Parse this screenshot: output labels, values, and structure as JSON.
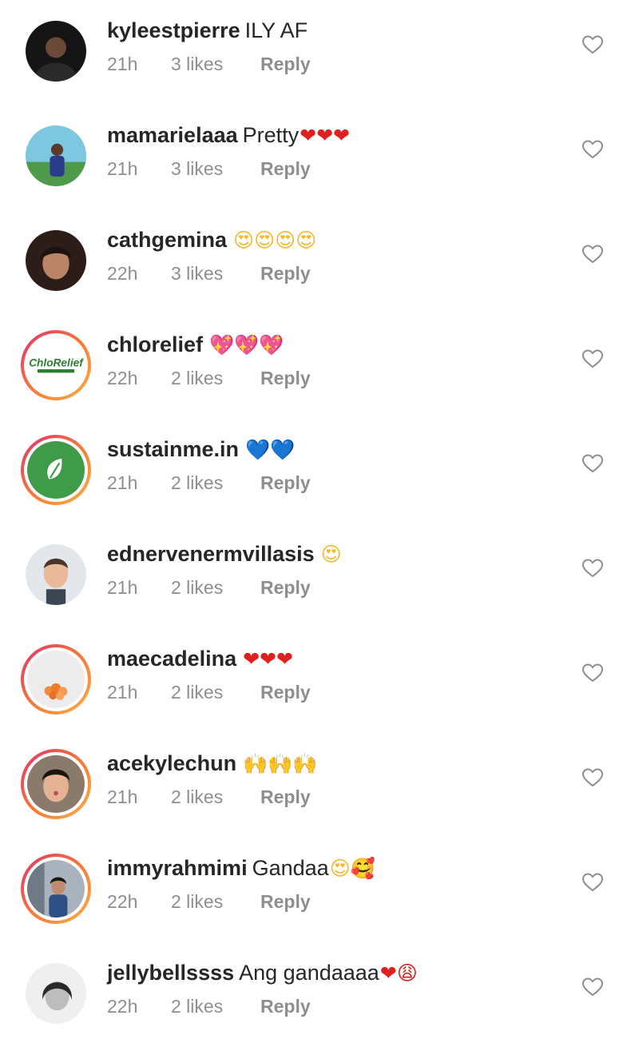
{
  "comments": [
    {
      "username": "kyleestpierre",
      "text": "ILY AF",
      "emoji": "",
      "emoji_color": "",
      "time": "21h",
      "likes": "3 likes",
      "reply": "Reply",
      "avatar_style": "plain",
      "avatar_bg": "#1b1b1b"
    },
    {
      "username": "mamarielaaa",
      "text": "Pretty",
      "emoji": "❤❤❤",
      "emoji_color": "red",
      "time": "21h",
      "likes": "3 likes",
      "reply": "Reply",
      "avatar_style": "plain",
      "avatar_bg": "#5bb0c9"
    },
    {
      "username": "cathgemina",
      "text": "",
      "emoji": "😍😍😍😍",
      "emoji_color": "yellow",
      "time": "22h",
      "likes": "3 likes",
      "reply": "Reply",
      "avatar_style": "plain",
      "avatar_bg": "#3a2620"
    },
    {
      "username": "chlorelief",
      "text": "",
      "emoji": "💖💖💖",
      "emoji_color": "pink",
      "time": "22h",
      "likes": "2 likes",
      "reply": "Reply",
      "avatar_style": "ring",
      "avatar_bg": "#ffffff",
      "avatar_text": "ChloRelief"
    },
    {
      "username": "sustainme.in",
      "text": "",
      "emoji": "💙💙",
      "emoji_color": "blue",
      "time": "21h",
      "likes": "2 likes",
      "reply": "Reply",
      "avatar_style": "ring",
      "avatar_bg": "#3f9a4a"
    },
    {
      "username": "ednervenermvillasis",
      "text": "",
      "emoji": "😍",
      "emoji_color": "yellow",
      "time": "21h",
      "likes": "2 likes",
      "reply": "Reply",
      "avatar_style": "plain",
      "avatar_bg": "#cfd6dc"
    },
    {
      "username": "maecadelina",
      "text": "",
      "emoji": "❤❤❤",
      "emoji_color": "red",
      "time": "21h",
      "likes": "2 likes",
      "reply": "Reply",
      "avatar_style": "ring",
      "avatar_bg": "#e9e9e9"
    },
    {
      "username": "acekylechun",
      "text": "",
      "emoji": "🙌🙌🙌",
      "emoji_color": "yellow",
      "time": "21h",
      "likes": "2 likes",
      "reply": "Reply",
      "avatar_style": "ring",
      "avatar_bg": "#6f5a4c"
    },
    {
      "username": "immyrahmimi",
      "text": "Gandaa",
      "emoji": "😍🥰",
      "emoji_color": "yellow",
      "time": "22h",
      "likes": "2 likes",
      "reply": "Reply",
      "avatar_style": "ring",
      "avatar_bg": "#7d8a9a"
    },
    {
      "username": "jellybellssss",
      "text": "Ang gandaaaa",
      "emoji": "❤😩",
      "emoji_color": "red",
      "time": "22h",
      "likes": "2 likes",
      "reply": "Reply",
      "avatar_style": "plain",
      "avatar_bg": "#d9d9d9"
    }
  ],
  "colors": {
    "text_primary": "#262626",
    "text_secondary": "#8e8e8e",
    "story_ring_start": "#e1306c",
    "story_ring_end": "#fcaf45"
  },
  "icons": {
    "like": "heart-outline-icon"
  }
}
